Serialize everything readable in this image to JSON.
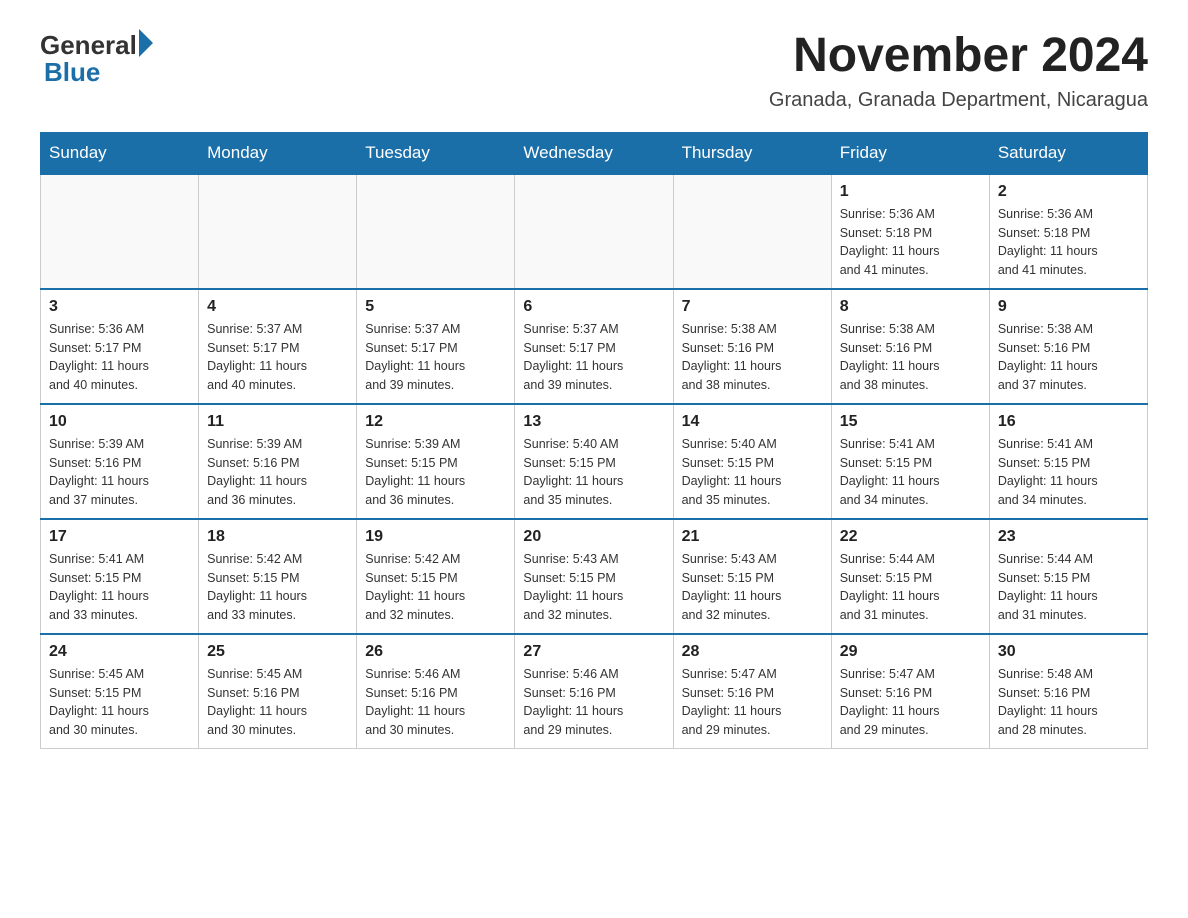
{
  "header": {
    "logo": {
      "text_general": "General",
      "text_blue": "Blue"
    },
    "month_year": "November 2024",
    "location": "Granada, Granada Department, Nicaragua"
  },
  "days_of_week": [
    "Sunday",
    "Monday",
    "Tuesday",
    "Wednesday",
    "Thursday",
    "Friday",
    "Saturday"
  ],
  "weeks": [
    [
      {
        "day": "",
        "info": ""
      },
      {
        "day": "",
        "info": ""
      },
      {
        "day": "",
        "info": ""
      },
      {
        "day": "",
        "info": ""
      },
      {
        "day": "",
        "info": ""
      },
      {
        "day": "1",
        "info": "Sunrise: 5:36 AM\nSunset: 5:18 PM\nDaylight: 11 hours\nand 41 minutes."
      },
      {
        "day": "2",
        "info": "Sunrise: 5:36 AM\nSunset: 5:18 PM\nDaylight: 11 hours\nand 41 minutes."
      }
    ],
    [
      {
        "day": "3",
        "info": "Sunrise: 5:36 AM\nSunset: 5:17 PM\nDaylight: 11 hours\nand 40 minutes."
      },
      {
        "day": "4",
        "info": "Sunrise: 5:37 AM\nSunset: 5:17 PM\nDaylight: 11 hours\nand 40 minutes."
      },
      {
        "day": "5",
        "info": "Sunrise: 5:37 AM\nSunset: 5:17 PM\nDaylight: 11 hours\nand 39 minutes."
      },
      {
        "day": "6",
        "info": "Sunrise: 5:37 AM\nSunset: 5:17 PM\nDaylight: 11 hours\nand 39 minutes."
      },
      {
        "day": "7",
        "info": "Sunrise: 5:38 AM\nSunset: 5:16 PM\nDaylight: 11 hours\nand 38 minutes."
      },
      {
        "day": "8",
        "info": "Sunrise: 5:38 AM\nSunset: 5:16 PM\nDaylight: 11 hours\nand 38 minutes."
      },
      {
        "day": "9",
        "info": "Sunrise: 5:38 AM\nSunset: 5:16 PM\nDaylight: 11 hours\nand 37 minutes."
      }
    ],
    [
      {
        "day": "10",
        "info": "Sunrise: 5:39 AM\nSunset: 5:16 PM\nDaylight: 11 hours\nand 37 minutes."
      },
      {
        "day": "11",
        "info": "Sunrise: 5:39 AM\nSunset: 5:16 PM\nDaylight: 11 hours\nand 36 minutes."
      },
      {
        "day": "12",
        "info": "Sunrise: 5:39 AM\nSunset: 5:15 PM\nDaylight: 11 hours\nand 36 minutes."
      },
      {
        "day": "13",
        "info": "Sunrise: 5:40 AM\nSunset: 5:15 PM\nDaylight: 11 hours\nand 35 minutes."
      },
      {
        "day": "14",
        "info": "Sunrise: 5:40 AM\nSunset: 5:15 PM\nDaylight: 11 hours\nand 35 minutes."
      },
      {
        "day": "15",
        "info": "Sunrise: 5:41 AM\nSunset: 5:15 PM\nDaylight: 11 hours\nand 34 minutes."
      },
      {
        "day": "16",
        "info": "Sunrise: 5:41 AM\nSunset: 5:15 PM\nDaylight: 11 hours\nand 34 minutes."
      }
    ],
    [
      {
        "day": "17",
        "info": "Sunrise: 5:41 AM\nSunset: 5:15 PM\nDaylight: 11 hours\nand 33 minutes."
      },
      {
        "day": "18",
        "info": "Sunrise: 5:42 AM\nSunset: 5:15 PM\nDaylight: 11 hours\nand 33 minutes."
      },
      {
        "day": "19",
        "info": "Sunrise: 5:42 AM\nSunset: 5:15 PM\nDaylight: 11 hours\nand 32 minutes."
      },
      {
        "day": "20",
        "info": "Sunrise: 5:43 AM\nSunset: 5:15 PM\nDaylight: 11 hours\nand 32 minutes."
      },
      {
        "day": "21",
        "info": "Sunrise: 5:43 AM\nSunset: 5:15 PM\nDaylight: 11 hours\nand 32 minutes."
      },
      {
        "day": "22",
        "info": "Sunrise: 5:44 AM\nSunset: 5:15 PM\nDaylight: 11 hours\nand 31 minutes."
      },
      {
        "day": "23",
        "info": "Sunrise: 5:44 AM\nSunset: 5:15 PM\nDaylight: 11 hours\nand 31 minutes."
      }
    ],
    [
      {
        "day": "24",
        "info": "Sunrise: 5:45 AM\nSunset: 5:15 PM\nDaylight: 11 hours\nand 30 minutes."
      },
      {
        "day": "25",
        "info": "Sunrise: 5:45 AM\nSunset: 5:16 PM\nDaylight: 11 hours\nand 30 minutes."
      },
      {
        "day": "26",
        "info": "Sunrise: 5:46 AM\nSunset: 5:16 PM\nDaylight: 11 hours\nand 30 minutes."
      },
      {
        "day": "27",
        "info": "Sunrise: 5:46 AM\nSunset: 5:16 PM\nDaylight: 11 hours\nand 29 minutes."
      },
      {
        "day": "28",
        "info": "Sunrise: 5:47 AM\nSunset: 5:16 PM\nDaylight: 11 hours\nand 29 minutes."
      },
      {
        "day": "29",
        "info": "Sunrise: 5:47 AM\nSunset: 5:16 PM\nDaylight: 11 hours\nand 29 minutes."
      },
      {
        "day": "30",
        "info": "Sunrise: 5:48 AM\nSunset: 5:16 PM\nDaylight: 11 hours\nand 28 minutes."
      }
    ]
  ]
}
